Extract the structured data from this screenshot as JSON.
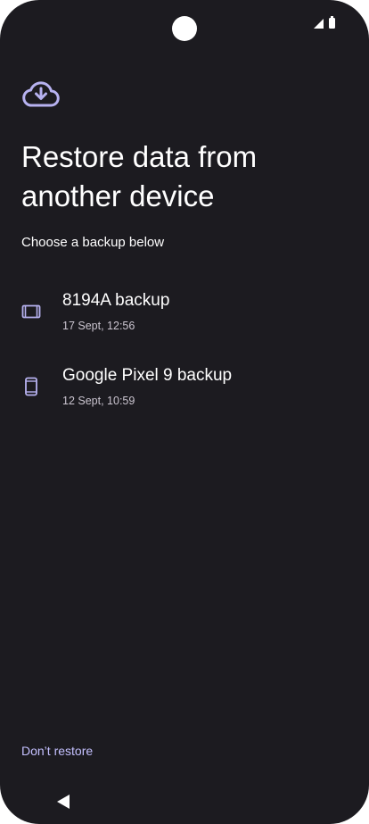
{
  "status_bar": {
    "icons": [
      "front-camera",
      "signal-icon",
      "battery-icon"
    ]
  },
  "header": {
    "icon": "cloud-download-icon",
    "title": "Restore data from another device",
    "subtitle": "Choose a backup below"
  },
  "backups": [
    {
      "icon": "tablet-icon",
      "name": "8194A backup",
      "date": "17 Sept, 12:56"
    },
    {
      "icon": "phone-icon",
      "name": "Google Pixel 9 backup",
      "date": "12 Sept, 10:59"
    }
  ],
  "footer": {
    "dont_restore_label": "Don’t restore"
  },
  "nav_bar": {
    "icon": "back-icon"
  },
  "colors": {
    "background": "#1c1b20",
    "accent": "#c4c0ff",
    "icon_tint": "#b7b2f0",
    "text_primary": "#ffffff",
    "text_secondary": "#cac4cf"
  }
}
